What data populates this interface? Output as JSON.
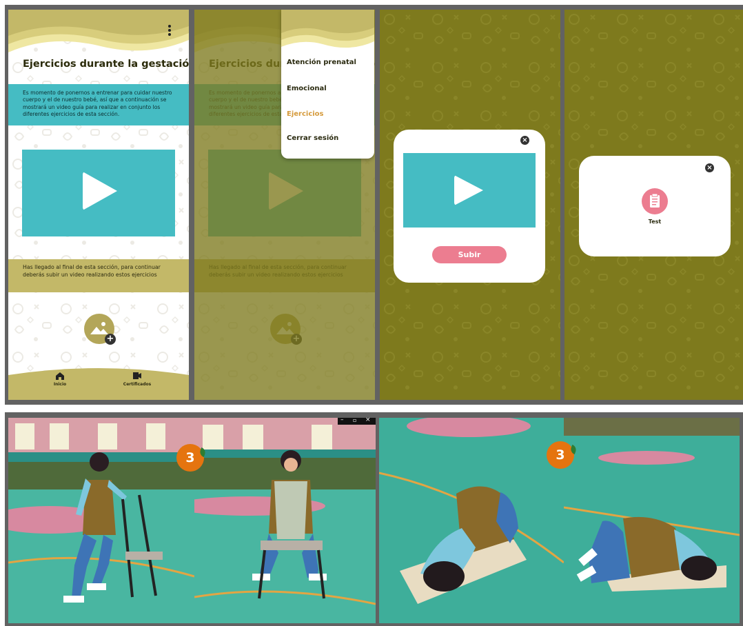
{
  "app_screen": {
    "title": "Ejercicios durante la gestación",
    "intro_text": "Es momento de ponernos a entrenar para cuidar nuestro cuerpo y el de nuestro bebé, así que a continuación se mostrará un video guía para realizar en conjunto los diferentes ejercicios de esta sección.",
    "end_text": "Has llegado al final de esta sección, para continuar deberás subir un video realizando estos ejercicios",
    "nav": {
      "home": "Inicio",
      "certificates": "Certificados"
    }
  },
  "menu": {
    "items": [
      "Atención prenatal",
      "Emocional",
      "Ejercicios",
      "Cerrar sesión"
    ],
    "active_index": 2
  },
  "upload_dialog": {
    "button": "Subir"
  },
  "test_dialog": {
    "label": "Test"
  },
  "photos": {
    "left_badge": "3",
    "right_badge": "3"
  },
  "colors": {
    "olive": "#7e7a1d",
    "sand": "#c3b868",
    "teal": "#45bcc3",
    "pink": "#ec7d90",
    "orange": "#e5740f"
  },
  "icons": [
    "kebab-menu-icon",
    "play-icon",
    "image-upload-icon",
    "home-icon",
    "certificate-video-icon",
    "close-icon",
    "clipboard-icon",
    "window-minimize-icon",
    "window-maximize-icon",
    "window-close-icon"
  ]
}
